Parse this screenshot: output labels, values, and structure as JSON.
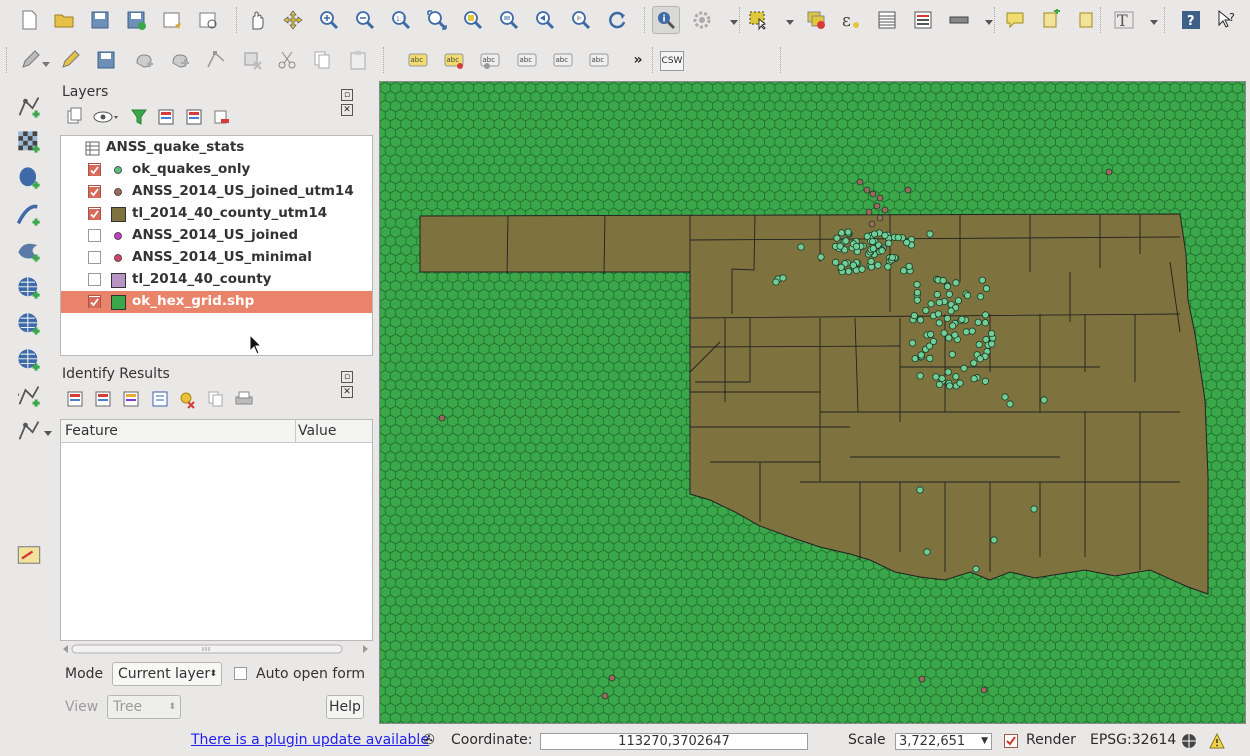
{
  "toolbar1": [
    {
      "name": "new-project-icon"
    },
    {
      "name": "open-project-icon"
    },
    {
      "name": "save-project-icon"
    },
    {
      "name": "save-as-icon"
    },
    {
      "name": "new-print-composer-icon"
    },
    {
      "name": "composer-manager-icon"
    },
    {
      "name": "pan-icon"
    },
    {
      "name": "pan-to-selection-icon"
    },
    {
      "name": "zoom-in-icon"
    },
    {
      "name": "zoom-out-icon"
    },
    {
      "name": "zoom-native-icon"
    },
    {
      "name": "zoom-full-icon"
    },
    {
      "name": "zoom-to-selection-icon"
    },
    {
      "name": "zoom-to-layer-icon"
    },
    {
      "name": "zoom-last-icon"
    },
    {
      "name": "zoom-next-icon"
    },
    {
      "name": "refresh-icon"
    },
    {
      "name": "identify-icon"
    },
    {
      "name": "action-icon"
    },
    {
      "name": "select-features-icon"
    },
    {
      "name": "deselect-icon"
    },
    {
      "name": "field-calculator-icon"
    },
    {
      "name": "attribute-table-icon"
    },
    {
      "name": "statistics-icon"
    },
    {
      "name": "measure-icon"
    },
    {
      "name": "map-tips-icon"
    },
    {
      "name": "new-bookmark-icon"
    },
    {
      "name": "show-bookmarks-icon"
    },
    {
      "name": "text-annotation-icon"
    },
    {
      "name": "help-icon"
    },
    {
      "name": "whats-this-icon"
    }
  ],
  "toolbar2": [
    {
      "name": "current-edits-icon"
    },
    {
      "name": "toggle-editing-icon"
    },
    {
      "name": "save-edits-icon"
    },
    {
      "name": "add-feature-icon"
    },
    {
      "name": "move-feature-icon"
    },
    {
      "name": "node-tool-icon"
    },
    {
      "name": "delete-selected-icon"
    },
    {
      "name": "cut-features-icon"
    },
    {
      "name": "copy-features-icon"
    },
    {
      "name": "paste-features-icon"
    },
    {
      "name": "label-icon"
    },
    {
      "name": "label-layer-icon"
    },
    {
      "name": "pin-labels-icon"
    },
    {
      "name": "show-hide-labels-icon"
    },
    {
      "name": "move-label-icon"
    },
    {
      "name": "rotate-label-icon"
    },
    {
      "name": "more-tools-icon"
    },
    {
      "name": "csw-icon"
    }
  ],
  "toolbar2_more": "»",
  "toolbar2_csw": "CSW",
  "left_tools": [
    {
      "name": "add-vector-layer-icon"
    },
    {
      "name": "add-raster-layer-icon"
    },
    {
      "name": "add-postgis-layer-icon"
    },
    {
      "name": "add-spatialite-layer-icon"
    },
    {
      "name": "add-mssql-layer-icon"
    },
    {
      "name": "add-wms-layer-icon"
    },
    {
      "name": "add-wcs-layer-icon"
    },
    {
      "name": "add-wfs-layer-icon"
    },
    {
      "name": "add-delimited-text-icon"
    },
    {
      "name": "new-shapefile-layer-icon"
    },
    {
      "name": "python-console-icon"
    }
  ],
  "layers_panel": {
    "title": "Layers",
    "items": [
      {
        "label": "ANSS_quake_stats",
        "checked": null,
        "symbol": "table",
        "color": ""
      },
      {
        "label": "ok_quakes_only",
        "checked": true,
        "symbol": "point",
        "color": "#5dbe7e"
      },
      {
        "label": "ANSS_2014_US_joined_utm14",
        "checked": true,
        "symbol": "point",
        "color": "#9c6a5c"
      },
      {
        "label": "tl_2014_40_county_utm14",
        "checked": true,
        "symbol": "fill",
        "color": "#7e733e"
      },
      {
        "label": "ANSS_2014_US_joined",
        "checked": false,
        "symbol": "point",
        "color": "#c43ec4"
      },
      {
        "label": "ANSS_2014_US_minimal",
        "checked": false,
        "symbol": "point",
        "color": "#d44067"
      },
      {
        "label": "tl_2014_40_county",
        "checked": false,
        "symbol": "fill",
        "color": "#b694c4"
      },
      {
        "label": "ok_hex_grid.shp",
        "checked": true,
        "symbol": "fill",
        "color": "#3aa84a",
        "selected": true
      }
    ]
  },
  "identify_panel": {
    "title": "Identify Results",
    "col_feature": "Feature",
    "col_value": "Value",
    "mode_label": "Mode",
    "mode_value": "Current layer",
    "auto_open_label": "Auto open form",
    "view_label": "View",
    "view_value": "Tree",
    "help_label": "Help"
  },
  "statusbar": {
    "plugin_update": "There is a plugin update available",
    "coordinate_label": "Coordinate:",
    "coordinate_value": "113270,3702647",
    "scale_label": "Scale",
    "scale_value": "3,722,651",
    "render_label": "Render",
    "crs": "EPSG:32614"
  },
  "map_colors": {
    "hex_fill": "#3aa84a",
    "hex_stroke": "#1f6a2c",
    "county_fill": "#7e733e",
    "county_stroke": "#222222",
    "quake_ok": "#6fcf97",
    "quake_us": "#9c6a5c"
  }
}
